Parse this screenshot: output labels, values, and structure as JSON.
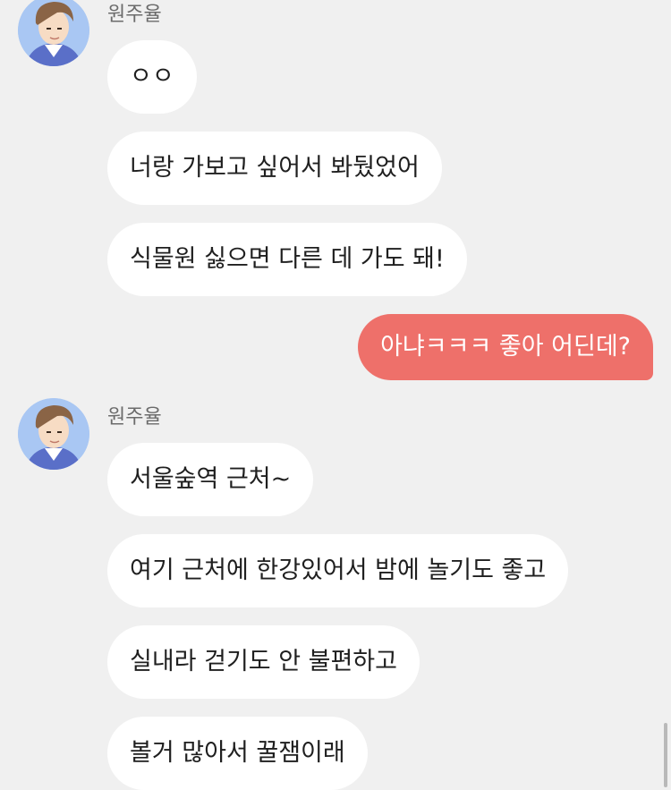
{
  "chat": {
    "groups": [
      {
        "sender": "원주율",
        "avatar_icon": "boy-avatar-icon",
        "messages": [
          "ㅇㅇ",
          "너랑 가보고 싶어서 봐뒀었어",
          "식물원 싫으면 다른 데 가도 돼!"
        ]
      },
      {
        "sender": "원주율",
        "avatar_icon": "boy-avatar-icon",
        "messages": [
          "서울숲역 근처~",
          "여기 근처에 한강있어서 밤에 놀기도 좋고",
          "실내라 걷기도 안 불편하고",
          "볼거 많아서 꿀잼이래"
        ]
      }
    ],
    "my_message": "아냐ㅋㅋㅋ 좋아 어딘데?"
  },
  "colors": {
    "background": "#f0f0f0",
    "received_bubble": "#ffffff",
    "sent_bubble": "#ee706a",
    "avatar_background": "#a9c7f3"
  }
}
